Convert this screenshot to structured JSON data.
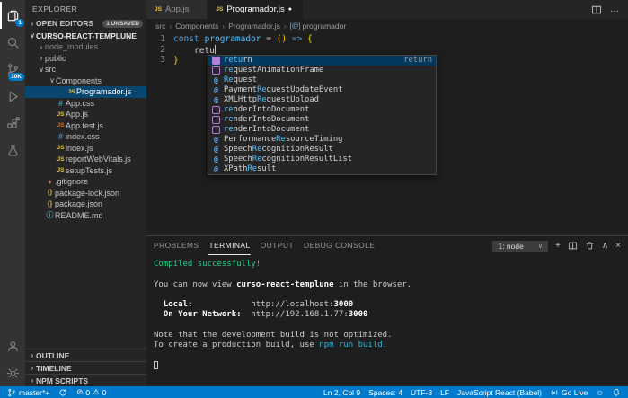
{
  "activityBar": {
    "explorerBadge": "1",
    "scmBadge": "10K",
    "icons": [
      "files",
      "search",
      "source-control",
      "run-and-debug",
      "extensions",
      "testing",
      "account",
      "settings"
    ]
  },
  "sidebar": {
    "title": "EXPLORER",
    "openEditors": {
      "label": "OPEN EDITORS",
      "badge": "1 UNSAVED",
      "chevron": "›"
    },
    "root": {
      "label": "CURSO-REACT-TEMPLUNE",
      "chevron": "∨"
    },
    "tree": [
      {
        "label": "node_modules",
        "type": "folder",
        "chevron": "›",
        "indent": 1,
        "dim": true
      },
      {
        "label": "public",
        "type": "folder",
        "chevron": "›",
        "indent": 1
      },
      {
        "label": "src",
        "type": "folder",
        "chevron": "∨",
        "indent": 1
      },
      {
        "label": "Components",
        "type": "folder",
        "chevron": "∨",
        "indent": 2
      },
      {
        "label": "Programador.js",
        "type": "js",
        "indent": 3,
        "selected": true
      },
      {
        "label": "App.css",
        "type": "css",
        "indent": 2
      },
      {
        "label": "App.js",
        "type": "js",
        "indent": 2
      },
      {
        "label": "App.test.js",
        "type": "jstest",
        "indent": 2
      },
      {
        "label": "index.css",
        "type": "css",
        "indent": 2
      },
      {
        "label": "index.js",
        "type": "js",
        "indent": 2
      },
      {
        "label": "reportWebVitals.js",
        "type": "js",
        "indent": 2
      },
      {
        "label": "setupTests.js",
        "type": "js",
        "indent": 2
      },
      {
        "label": ".gitignore",
        "type": "git",
        "indent": 1
      },
      {
        "label": "package-lock.json",
        "type": "json",
        "indent": 1
      },
      {
        "label": "package.json",
        "type": "json",
        "indent": 1
      },
      {
        "label": "README.md",
        "type": "md",
        "indent": 1
      }
    ],
    "sections": [
      {
        "label": "OUTLINE"
      },
      {
        "label": "TIMELINE"
      },
      {
        "label": "NPM SCRIPTS"
      }
    ]
  },
  "editor": {
    "tabs": [
      {
        "label": "App.js",
        "icon": "js"
      },
      {
        "label": "Programador.js",
        "icon": "js",
        "active": true,
        "modified": true
      }
    ],
    "breadcrumb": [
      {
        "label": "src"
      },
      {
        "label": "Components"
      },
      {
        "label": "Programador.js"
      },
      {
        "label": "programador",
        "symbol": true
      }
    ],
    "lineNumbers": [
      "1",
      "2",
      "3"
    ],
    "code": {
      "kw": "const",
      "fnName": "programador",
      "assign": " = ",
      "parens": "()",
      "arrow": " => ",
      "openBrace": "{",
      "typed": "retu",
      "closeBrace": "}"
    },
    "suggest": [
      {
        "icon": "keyword",
        "pre": "",
        "match": "retu",
        "post": "rn",
        "detail": "return",
        "selected": true
      },
      {
        "icon": "method",
        "pre": "",
        "match": "re",
        "post": "questAnimationFrame"
      },
      {
        "icon": "event",
        "pre": "",
        "match": "Re",
        "post": "quest"
      },
      {
        "icon": "event",
        "pre": "Payment",
        "match": "Re",
        "post": "questUpdateEvent"
      },
      {
        "icon": "event",
        "pre": "XMLHttp",
        "match": "Re",
        "post": "questUpload"
      },
      {
        "icon": "method",
        "pre": "",
        "match": "re",
        "post": "nderIntoDocument"
      },
      {
        "icon": "method",
        "pre": "",
        "match": "re",
        "post": "nderIntoDocument"
      },
      {
        "icon": "method",
        "pre": "",
        "match": "re",
        "post": "nderIntoDocument"
      },
      {
        "icon": "event",
        "pre": "Performance",
        "match": "Re",
        "post": "sourceTiming"
      },
      {
        "icon": "event",
        "pre": "Speech",
        "match": "Re",
        "post": "cognitionResult"
      },
      {
        "icon": "event",
        "pre": "Speech",
        "match": "Re",
        "post": "cognitionResultList"
      },
      {
        "icon": "event",
        "pre": "XPath",
        "match": "Re",
        "post": "sult"
      }
    ]
  },
  "panel": {
    "tabs": [
      {
        "label": "PROBLEMS"
      },
      {
        "label": "TERMINAL",
        "active": true
      },
      {
        "label": "OUTPUT"
      },
      {
        "label": "DEBUG CONSOLE"
      }
    ],
    "dropdown": "1: node",
    "terminal": {
      "compiled": "Compiled successfully!",
      "view1": "You can now view ",
      "view2": "curso-react-templune",
      "view3": " in the browser.",
      "localLabel": "  Local:",
      "localUrl": "            http://localhost:",
      "localPort": "3000",
      "networkLabel": "  On Your Network:",
      "networkUrl": "  http://192.168.1.77:",
      "networkPort": "3000",
      "note": "Note that the development build is not optimized.",
      "build1": "To create a production build, use ",
      "build2": "npm run build",
      "build3": "."
    }
  },
  "statusBar": {
    "branch": "master*+",
    "errors": "0",
    "warnings": "0",
    "line": "Ln 2, Col 9",
    "spaces": "Spaces: 4",
    "encoding": "UTF-8",
    "eol": "LF",
    "language": "JavaScript React (Babel)",
    "goLive": "Go Live"
  },
  "colors": {
    "accent": "#007acc",
    "terminalGreen": "#23d18b",
    "terminalCyan": "#29b8db",
    "listSelection": "#094771",
    "suggestSelection": "#04395e"
  }
}
